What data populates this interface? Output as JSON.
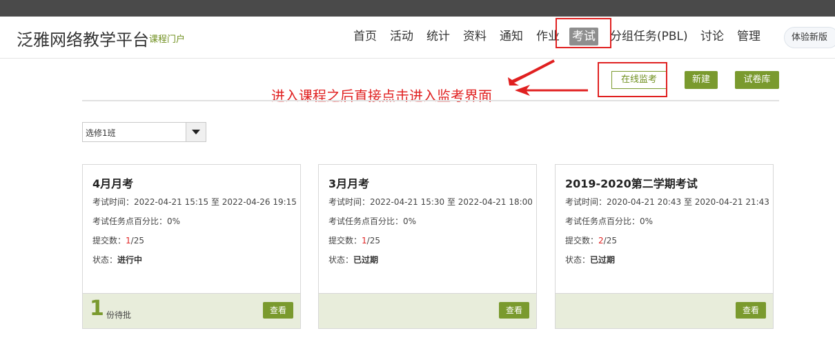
{
  "header": {
    "brand": "泛雅网络教学平台",
    "brand_sub": "课程门户",
    "nav": [
      "首页",
      "活动",
      "统计",
      "资料",
      "通知",
      "作业",
      "考试",
      "分组任务(PBL)",
      "讨论",
      "管理"
    ],
    "active_nav": "考试",
    "new_version_label": "体验新版"
  },
  "toolbar": {
    "monitor_label": "在线监考",
    "new_label": "新建",
    "library_label": "试卷库"
  },
  "annotation": {
    "text": "进入课程之后直接点击进入监考界面",
    "color": "#e02020"
  },
  "class_select": {
    "value": "选修1班"
  },
  "exams": [
    {
      "title": "4月月考",
      "time_label": "考试时间：",
      "time": "2022-04-21 15:15 至 2022-04-26 19:15",
      "percent_label": "考试任务点百分比：",
      "percent": "0%",
      "submit_label": "提交数：",
      "submitted": "1",
      "total": "/25",
      "status_label": "状态：",
      "status": "进行中",
      "pending_num": "1",
      "pending_label": "份待批",
      "view_label": "查看"
    },
    {
      "title": "3月月考",
      "time_label": "考试时间：",
      "time": "2022-04-21 15:30 至 2022-04-21 18:00",
      "percent_label": "考试任务点百分比：",
      "percent": "0%",
      "submit_label": "提交数：",
      "submitted": "1",
      "total": "/25",
      "status_label": "状态：",
      "status": "已过期",
      "view_label": "查看"
    },
    {
      "title": "2019-2020第二学期考试",
      "time_label": "考试时间：",
      "time": "2020-04-21 20:43 至 2020-04-21 21:43",
      "percent_label": "考试任务点百分比：",
      "percent": "0%",
      "submit_label": "提交数：",
      "submitted": "2",
      "total": "/25",
      "status_label": "状态：",
      "status": "已过期",
      "view_label": "查看"
    }
  ],
  "colors": {
    "accent": "#7a9a2e",
    "footer_bg": "#e8eddb",
    "topbar": "#4a4a4a"
  }
}
